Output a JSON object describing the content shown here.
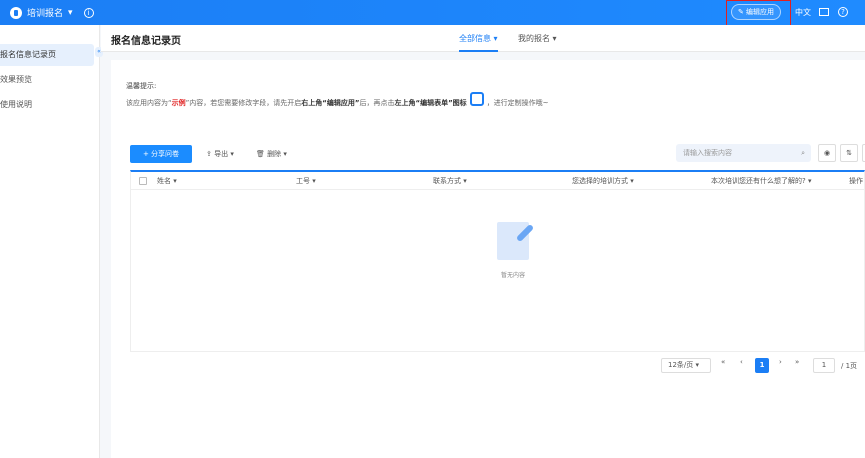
{
  "topbar": {
    "app_name": "培训报名",
    "edit_app": "编辑应用",
    "lang": "中文"
  },
  "sidebar": {
    "items": [
      {
        "label": "报名信息记录页"
      },
      {
        "label": "效果预览"
      },
      {
        "label": "使用说明"
      }
    ]
  },
  "header": {
    "title": "报名信息记录页",
    "tabs": [
      {
        "label": "全部信息 ▾"
      },
      {
        "label": "我的报名 ▾"
      }
    ]
  },
  "tip": {
    "heading": "温馨提示:",
    "p1": "该应用内容为“",
    "red": "示例",
    "p2": "”内容，若您需要修改字段，请先开启",
    "b1": "右上角“编辑应用”",
    "p3": "后，再点击",
    "b2": "左上角“编辑表单”图标",
    "p4": "，进行定制操作哦~"
  },
  "toolbar": {
    "share": "+ 分享问卷",
    "export": "导出 ▾",
    "delete": "删除 ▾",
    "search_placeholder": "请输入搜索内容"
  },
  "table": {
    "columns": [
      "姓名 ▾",
      "工号 ▾",
      "联系方式 ▾",
      "您选择的培训方式 ▾",
      "本次培训您还有什么想了解的? ▾",
      "操作"
    ],
    "empty": "暂无内容"
  },
  "pagination": {
    "page_size": "12条/页 ▾",
    "current": "1",
    "goto": "1",
    "total": "/ 1页"
  }
}
